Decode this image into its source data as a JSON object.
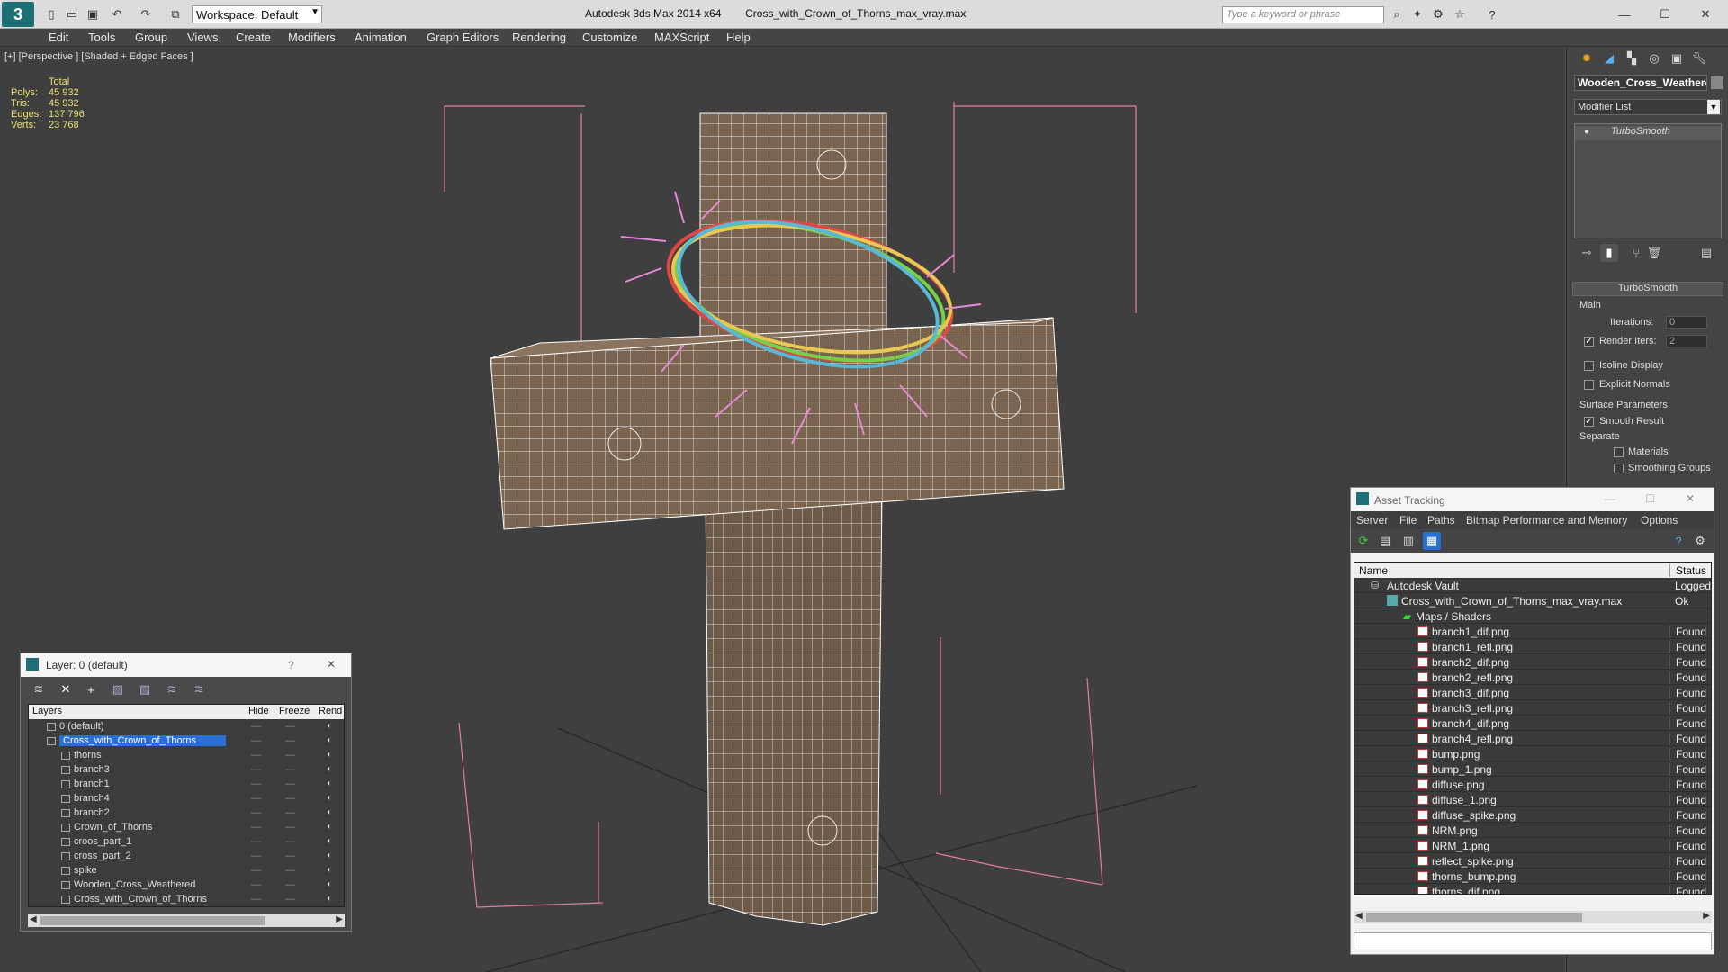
{
  "app": {
    "title": "Autodesk 3ds Max  2014 x64",
    "file": "Cross_with_Crown_of_Thorns_max_vray.max",
    "workspace": "Workspace: Default",
    "search_placeholder": "Type a keyword or phrase"
  },
  "menu": [
    "Edit",
    "Tools",
    "Group",
    "Views",
    "Create",
    "Modifiers",
    "Animation",
    "Graph Editors",
    "Rendering",
    "Customize",
    "MAXScript",
    "Help"
  ],
  "viewport": {
    "label": "[+] [Perspective ] [Shaded + Edged Faces ]",
    "stats_header": "Total",
    "stats": [
      {
        "label": "Polys:",
        "value": "45 932"
      },
      {
        "label": "Tris:",
        "value": "45 932"
      },
      {
        "label": "Edges:",
        "value": "137 796"
      },
      {
        "label": "Verts:",
        "value": "23 768"
      }
    ]
  },
  "command_panel": {
    "object_name": "Wooden_Cross_Weathere",
    "modifier_list": "Modifier List",
    "stack_item": "TurboSmooth",
    "rollout_title": "TurboSmooth",
    "main_group": "Main",
    "iterations_label": "Iterations:",
    "iterations_value": "0",
    "render_iters_label": "Render Iters:",
    "render_iters_value": "2",
    "isoline_label": "Isoline Display",
    "explicit_label": "Explicit Normals",
    "surface_group": "Surface Parameters",
    "smooth_result_label": "Smooth Result",
    "separate_label": "Separate",
    "materials_label": "Materials",
    "smoothing_label": "Smoothing Groups"
  },
  "layer_window": {
    "title": "Layer: 0 (default)",
    "help": "?",
    "close": "✕",
    "columns": [
      "Layers",
      "Hide",
      "Freeze",
      "Rend"
    ],
    "layers": [
      {
        "name": "0 (default)",
        "indent": 1
      },
      {
        "name": "Cross_with_Crown_of_Thorns",
        "indent": 1
      },
      {
        "name": "thorns",
        "indent": 2
      },
      {
        "name": "branch3",
        "indent": 2
      },
      {
        "name": "branch1",
        "indent": 2
      },
      {
        "name": "branch4",
        "indent": 2
      },
      {
        "name": "branch2",
        "indent": 2
      },
      {
        "name": "Crown_of_Thorns",
        "indent": 2
      },
      {
        "name": "croos_part_1",
        "indent": 2
      },
      {
        "name": "cross_part_2",
        "indent": 2
      },
      {
        "name": "spike",
        "indent": 2
      },
      {
        "name": "Wooden_Cross_Weathered",
        "indent": 2
      },
      {
        "name": "Cross_with_Crown_of_Thorns",
        "indent": 2
      }
    ]
  },
  "asset_window": {
    "title": "Asset Tracking",
    "menus": [
      "Server",
      "File",
      "Paths",
      "Bitmap Performance and Memory",
      "Options"
    ],
    "columns": [
      "Name",
      "Status"
    ],
    "vault": {
      "name": "Autodesk Vault",
      "status": "Logged"
    },
    "scene": {
      "name": "Cross_with_Crown_of_Thorns_max_vray.max",
      "status": "Ok"
    },
    "group": "Maps / Shaders",
    "files": [
      {
        "name": "branch1_dif.png",
        "status": "Found"
      },
      {
        "name": "branch1_refl.png",
        "status": "Found"
      },
      {
        "name": "branch2_dif.png",
        "status": "Found"
      },
      {
        "name": "branch2_refl.png",
        "status": "Found"
      },
      {
        "name": "branch3_dif.png",
        "status": "Found"
      },
      {
        "name": "branch3_refl.png",
        "status": "Found"
      },
      {
        "name": "branch4_dif.png",
        "status": "Found"
      },
      {
        "name": "branch4_refl.png",
        "status": "Found"
      },
      {
        "name": "bump.png",
        "status": "Found"
      },
      {
        "name": "bump_1.png",
        "status": "Found"
      },
      {
        "name": "diffuse.png",
        "status": "Found"
      },
      {
        "name": "diffuse_1.png",
        "status": "Found"
      },
      {
        "name": "diffuse_spike.png",
        "status": "Found"
      },
      {
        "name": "NRM.png",
        "status": "Found"
      },
      {
        "name": "NRM_1.png",
        "status": "Found"
      },
      {
        "name": "reflect_spike.png",
        "status": "Found"
      },
      {
        "name": "thorns_bump.png",
        "status": "Found"
      },
      {
        "name": "thorns_dif.png",
        "status": "Found"
      }
    ]
  },
  "colors": {
    "selection": "#2a6fd6",
    "bbox": "#e07aa8",
    "wood": "#7a6450"
  }
}
